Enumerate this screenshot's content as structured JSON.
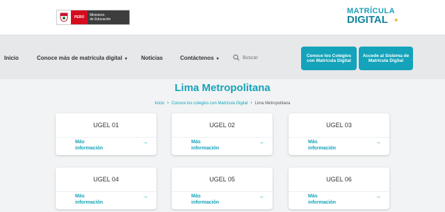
{
  "header": {
    "gov": {
      "country": "PERÚ",
      "ministry_line1": "Ministerio",
      "ministry_line2": "de Educación"
    },
    "brand": {
      "line1": "MATRÍCULA",
      "line2": "DIGITAL"
    }
  },
  "nav": {
    "items": [
      {
        "label": "Inicio"
      },
      {
        "label": "Conoce más de matrícula digital",
        "caret": "▾"
      },
      {
        "label": "Noticias"
      },
      {
        "label": "Contáctenos",
        "caret": "▾"
      }
    ],
    "search_placeholder": "Buscar",
    "buttons": [
      {
        "label": "Conoce los Colegios con Matrícula Digital"
      },
      {
        "label": "Accede al Sistema de Matrícula Digital"
      }
    ]
  },
  "main": {
    "title": "Lima Metropolitana",
    "breadcrumb": [
      {
        "label": "Inicio"
      },
      {
        "label": "Conoce los colegios con Matrícula Digital"
      },
      {
        "label": "Lima Metropolitana"
      }
    ],
    "breadcrumb_sep": "•",
    "card_link": "Más\ninformación",
    "card_arrow": "→",
    "cards": [
      {
        "title": "UGEL 01"
      },
      {
        "title": "UGEL 02"
      },
      {
        "title": "UGEL 03"
      },
      {
        "title": "UGEL 04"
      },
      {
        "title": "UGEL 05"
      },
      {
        "title": "UGEL 06"
      }
    ]
  },
  "colors": {
    "accent": "#14a3ba",
    "gov_red": "#d50c1e",
    "nav_bg": "#e6e8ea"
  }
}
